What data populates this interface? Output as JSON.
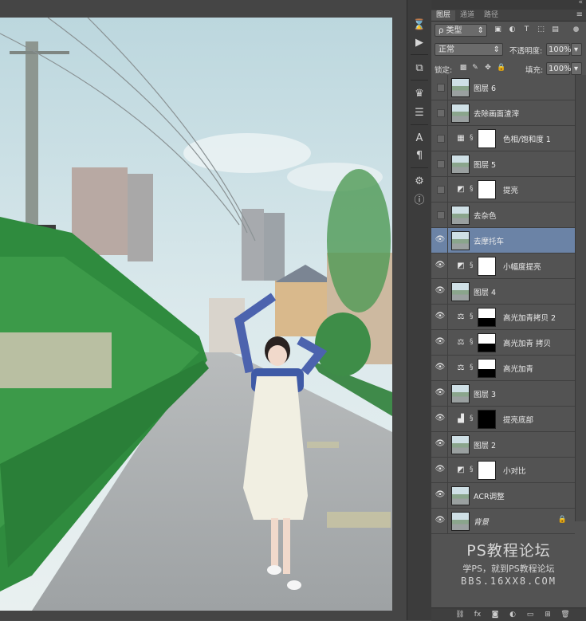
{
  "panel": {
    "tabs": [
      "图层",
      "通道",
      "路径"
    ],
    "active_tab": 0,
    "kind_filter": "ρ 类型",
    "blend_mode": "正常",
    "opacity_label": "不透明度:",
    "opacity_value": "100%",
    "lock_label": "锁定:",
    "fill_label": "填充:",
    "fill_value": "100%"
  },
  "layers": [
    {
      "name": "图层 6",
      "visible": false,
      "type": "pixel"
    },
    {
      "name": "去除画面渣滓",
      "visible": false,
      "type": "pixel"
    },
    {
      "name": "色相/饱和度 1",
      "visible": false,
      "type": "adjustment",
      "adj_icon": "hue-sat-icon",
      "mask": "white"
    },
    {
      "name": "图层 5",
      "visible": false,
      "type": "pixel"
    },
    {
      "name": "提亮",
      "visible": false,
      "type": "adjustment",
      "adj_icon": "curves-icon",
      "mask": "white"
    },
    {
      "name": "去杂色",
      "visible": false,
      "type": "pixel"
    },
    {
      "name": "去摩托车",
      "visible": true,
      "type": "pixel",
      "selected": true
    },
    {
      "name": "小幅度提亮",
      "visible": true,
      "type": "adjustment",
      "adj_icon": "curves-icon",
      "mask": "white"
    },
    {
      "name": "图层 4",
      "visible": true,
      "type": "pixel"
    },
    {
      "name": "高光加青拷贝 2",
      "visible": true,
      "type": "adjustment",
      "adj_icon": "balance-icon",
      "mask": "partial"
    },
    {
      "name": "高光加青 拷贝",
      "visible": true,
      "type": "adjustment",
      "adj_icon": "balance-icon",
      "mask": "partial"
    },
    {
      "name": "高光加青",
      "visible": true,
      "type": "adjustment",
      "adj_icon": "balance-icon",
      "mask": "partial"
    },
    {
      "name": "图层 3",
      "visible": true,
      "type": "pixel"
    },
    {
      "name": "提亮底部",
      "visible": true,
      "type": "adjustment",
      "adj_icon": "levels-icon",
      "mask": "black"
    },
    {
      "name": "图层 2",
      "visible": true,
      "type": "pixel"
    },
    {
      "name": "小对比",
      "visible": true,
      "type": "adjustment",
      "adj_icon": "curves-icon",
      "mask": "white"
    },
    {
      "name": "ACR调整",
      "visible": true,
      "type": "pixel"
    },
    {
      "name": "背景",
      "visible": true,
      "type": "pixel",
      "locked": true,
      "italic": true
    }
  ],
  "watermark": {
    "title": "PS教程论坛",
    "subtitle": "学PS，就到PS教程论坛",
    "url": "BBS.16XX8.COM"
  },
  "icons": {
    "eye": "eye-icon",
    "link": "chain-link-icon",
    "lock": "lock-icon"
  },
  "colors": {
    "panel_bg": "#535353",
    "selected_layer": "#6b83a6",
    "canvas_bg": "#454545"
  }
}
